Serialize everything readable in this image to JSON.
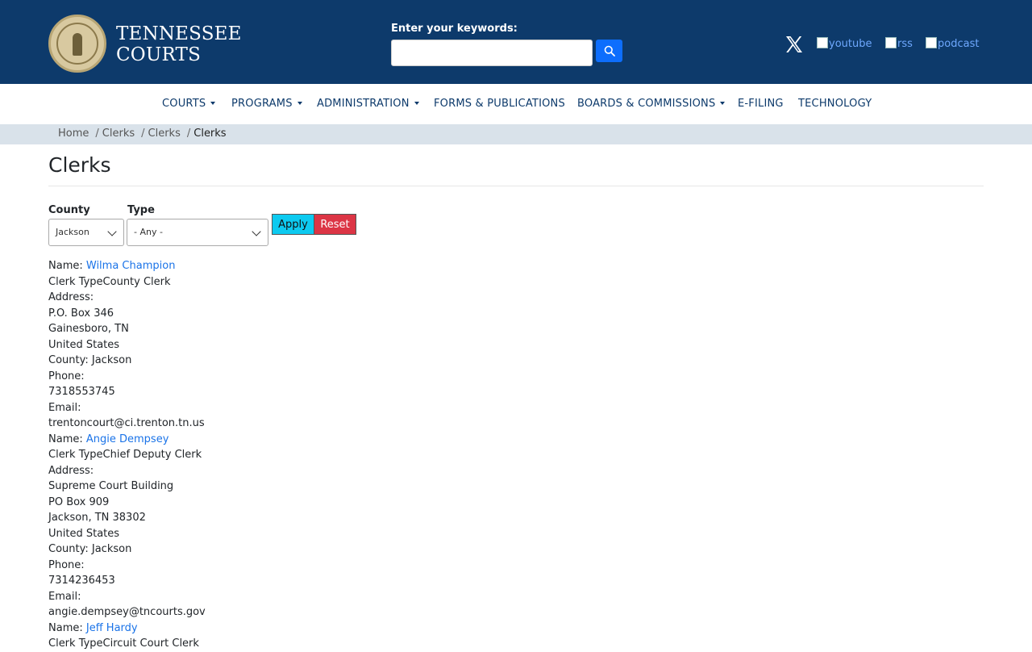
{
  "header": {
    "brand_line1": "TENNESSEE",
    "brand_line2": "COURTS",
    "search_label": "Enter your keywords:",
    "search_value": "",
    "social": [
      "youtube",
      "rss",
      "podcast"
    ]
  },
  "nav": {
    "items": [
      {
        "label": "COURTS",
        "dropdown": true
      },
      {
        "label": "PROGRAMS",
        "dropdown": true
      },
      {
        "label": "ADMINISTRATION",
        "dropdown": true
      },
      {
        "label": "FORMS & PUBLICATIONS",
        "dropdown": false
      },
      {
        "label": "BOARDS & COMMISSIONS",
        "dropdown": true
      },
      {
        "label": "E-FILING",
        "dropdown": false
      },
      {
        "label": "TECHNOLOGY",
        "dropdown": false
      }
    ]
  },
  "breadcrumb": [
    "Home",
    "Clerks",
    "Clerks",
    "Clerks"
  ],
  "page": {
    "title": "Clerks"
  },
  "filters": {
    "county_label": "County",
    "county_value": "Jackson",
    "type_label": "Type",
    "type_value": "- Any -",
    "apply_label": "Apply",
    "reset_label": "Reset"
  },
  "results": [
    {
      "name_prefix": "Name: ",
      "name": "Wilma Champion",
      "clerk_type": "Clerk TypeCounty Clerk",
      "address_label": "Address:",
      "address_lines": [
        "P.O. Box 346",
        "Gainesboro, TN",
        "United States"
      ],
      "county": "County: Jackson",
      "phone_label": "Phone:",
      "phone": "7318553745",
      "email_label": "Email:",
      "email": "trentoncourt@ci.trenton.tn.us"
    },
    {
      "name_prefix": "Name: ",
      "name": "Angie Dempsey",
      "clerk_type": "Clerk TypeChief Deputy Clerk",
      "address_label": "Address:",
      "address_lines": [
        "Supreme Court Building",
        "PO Box 909",
        "Jackson, TN 38302",
        "United States"
      ],
      "county": "County: Jackson",
      "phone_label": "Phone:",
      "phone": "7314236453",
      "email_label": "Email:",
      "email": "angie.dempsey@tncourts.gov"
    },
    {
      "name_prefix": "Name: ",
      "name": "Jeff Hardy",
      "clerk_type": "Clerk TypeCircuit Court Clerk"
    }
  ]
}
